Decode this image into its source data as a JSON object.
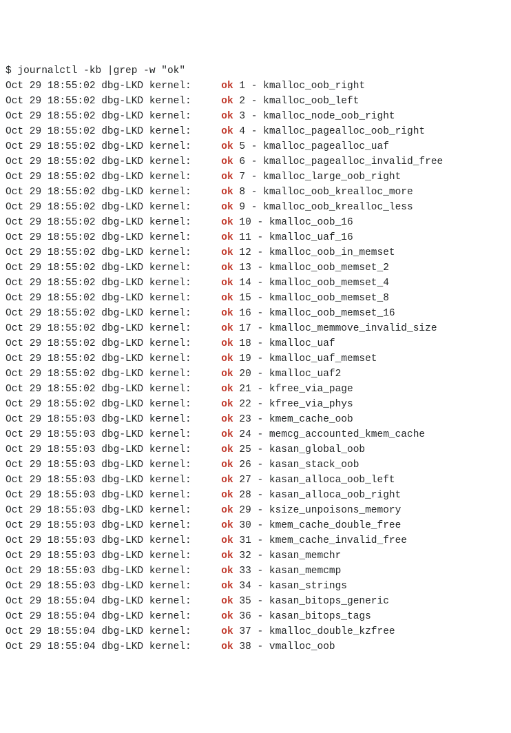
{
  "command": {
    "prompt": "$ ",
    "text": "journalctl -kb |grep -w \"ok\""
  },
  "log": {
    "host": "dbg-LKD",
    "source": "kernel:",
    "status_word": "ok",
    "lines": [
      {
        "date": "Oct 29",
        "time": "18:55:02",
        "num": 1,
        "test": "kmalloc_oob_right"
      },
      {
        "date": "Oct 29",
        "time": "18:55:02",
        "num": 2,
        "test": "kmalloc_oob_left"
      },
      {
        "date": "Oct 29",
        "time": "18:55:02",
        "num": 3,
        "test": "kmalloc_node_oob_right"
      },
      {
        "date": "Oct 29",
        "time": "18:55:02",
        "num": 4,
        "test": "kmalloc_pagealloc_oob_right"
      },
      {
        "date": "Oct 29",
        "time": "18:55:02",
        "num": 5,
        "test": "kmalloc_pagealloc_uaf"
      },
      {
        "date": "Oct 29",
        "time": "18:55:02",
        "num": 6,
        "test": "kmalloc_pagealloc_invalid_free"
      },
      {
        "date": "Oct 29",
        "time": "18:55:02",
        "num": 7,
        "test": "kmalloc_large_oob_right"
      },
      {
        "date": "Oct 29",
        "time": "18:55:02",
        "num": 8,
        "test": "kmalloc_oob_krealloc_more"
      },
      {
        "date": "Oct 29",
        "time": "18:55:02",
        "num": 9,
        "test": "kmalloc_oob_krealloc_less"
      },
      {
        "date": "Oct 29",
        "time": "18:55:02",
        "num": 10,
        "test": "kmalloc_oob_16"
      },
      {
        "date": "Oct 29",
        "time": "18:55:02",
        "num": 11,
        "test": "kmalloc_uaf_16"
      },
      {
        "date": "Oct 29",
        "time": "18:55:02",
        "num": 12,
        "test": "kmalloc_oob_in_memset"
      },
      {
        "date": "Oct 29",
        "time": "18:55:02",
        "num": 13,
        "test": "kmalloc_oob_memset_2"
      },
      {
        "date": "Oct 29",
        "time": "18:55:02",
        "num": 14,
        "test": "kmalloc_oob_memset_4"
      },
      {
        "date": "Oct 29",
        "time": "18:55:02",
        "num": 15,
        "test": "kmalloc_oob_memset_8"
      },
      {
        "date": "Oct 29",
        "time": "18:55:02",
        "num": 16,
        "test": "kmalloc_oob_memset_16"
      },
      {
        "date": "Oct 29",
        "time": "18:55:02",
        "num": 17,
        "test": "kmalloc_memmove_invalid_size"
      },
      {
        "date": "Oct 29",
        "time": "18:55:02",
        "num": 18,
        "test": "kmalloc_uaf"
      },
      {
        "date": "Oct 29",
        "time": "18:55:02",
        "num": 19,
        "test": "kmalloc_uaf_memset"
      },
      {
        "date": "Oct 29",
        "time": "18:55:02",
        "num": 20,
        "test": "kmalloc_uaf2"
      },
      {
        "date": "Oct 29",
        "time": "18:55:02",
        "num": 21,
        "test": "kfree_via_page"
      },
      {
        "date": "Oct 29",
        "time": "18:55:02",
        "num": 22,
        "test": "kfree_via_phys"
      },
      {
        "date": "Oct 29",
        "time": "18:55:03",
        "num": 23,
        "test": "kmem_cache_oob"
      },
      {
        "date": "Oct 29",
        "time": "18:55:03",
        "num": 24,
        "test": "memcg_accounted_kmem_cache"
      },
      {
        "date": "Oct 29",
        "time": "18:55:03",
        "num": 25,
        "test": "kasan_global_oob"
      },
      {
        "date": "Oct 29",
        "time": "18:55:03",
        "num": 26,
        "test": "kasan_stack_oob"
      },
      {
        "date": "Oct 29",
        "time": "18:55:03",
        "num": 27,
        "test": "kasan_alloca_oob_left"
      },
      {
        "date": "Oct 29",
        "time": "18:55:03",
        "num": 28,
        "test": "kasan_alloca_oob_right"
      },
      {
        "date": "Oct 29",
        "time": "18:55:03",
        "num": 29,
        "test": "ksize_unpoisons_memory"
      },
      {
        "date": "Oct 29",
        "time": "18:55:03",
        "num": 30,
        "test": "kmem_cache_double_free"
      },
      {
        "date": "Oct 29",
        "time": "18:55:03",
        "num": 31,
        "test": "kmem_cache_invalid_free"
      },
      {
        "date": "Oct 29",
        "time": "18:55:03",
        "num": 32,
        "test": "kasan_memchr"
      },
      {
        "date": "Oct 29",
        "time": "18:55:03",
        "num": 33,
        "test": "kasan_memcmp"
      },
      {
        "date": "Oct 29",
        "time": "18:55:03",
        "num": 34,
        "test": "kasan_strings"
      },
      {
        "date": "Oct 29",
        "time": "18:55:04",
        "num": 35,
        "test": "kasan_bitops_generic"
      },
      {
        "date": "Oct 29",
        "time": "18:55:04",
        "num": 36,
        "test": "kasan_bitops_tags"
      },
      {
        "date": "Oct 29",
        "time": "18:55:04",
        "num": 37,
        "test": "kmalloc_double_kzfree"
      },
      {
        "date": "Oct 29",
        "time": "18:55:04",
        "num": 38,
        "test": "vmalloc_oob"
      }
    ]
  }
}
